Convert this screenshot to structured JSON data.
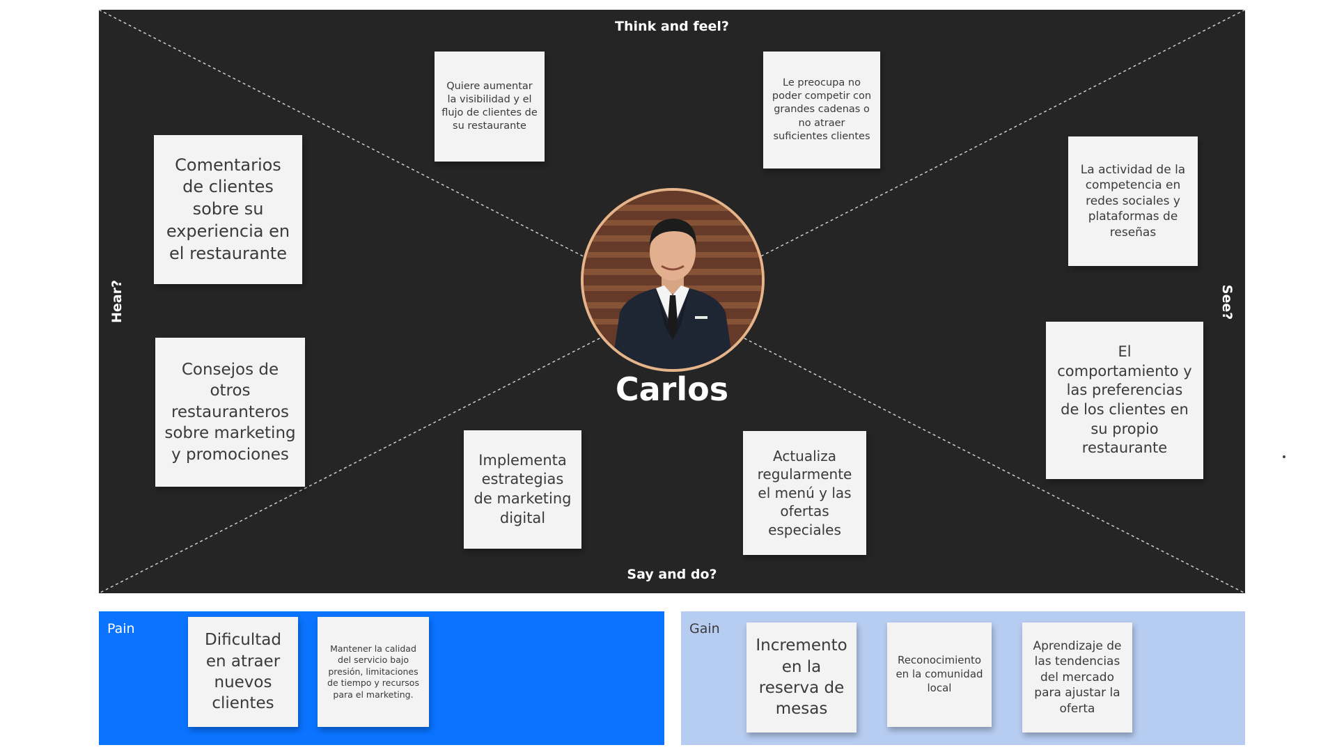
{
  "empathy_map": {
    "quadrants": {
      "top": "Think and feel?",
      "bottom": "Say and do?",
      "left": "Hear?",
      "right": "See?"
    },
    "persona": {
      "name": "Carlos",
      "photo": "portrait of a smiling man in a dark suit and tie"
    },
    "notes": {
      "think_1": "Quiere aumentar la visibilidad y el flujo de clientes de su restaurante",
      "think_2": "Le preocupa no poder competir con grandes cadenas o no atraer suficientes clientes",
      "hear_1": "Comentarios de clientes sobre su experiencia en el restaurante",
      "hear_2": "Consejos de otros restauranteros sobre marketing y promociones",
      "see_1": "La actividad de la competencia en redes sociales y plataformas de reseñas",
      "see_2": "El comportamiento y las preferencias de los clientes en su propio restaurante",
      "say_1": "Implementa estrategias de marketing digital",
      "say_2": "Actualiza regularmente el menú y las ofertas especiales"
    }
  },
  "pain": {
    "label": "Pain",
    "notes": [
      "Dificultad en atraer nuevos clientes",
      "Mantener la calidad del servicio bajo presión, limitaciones de tiempo y recursos para el marketing."
    ]
  },
  "gain": {
    "label": "Gain",
    "notes": [
      "Incremento en la reserva de mesas",
      "Reconocimiento en la comunidad local",
      "Aprendizaje de las tendencias del mercado para ajustar la oferta"
    ]
  },
  "colors": {
    "board": "#252525",
    "pain": "#0a73ff",
    "gain": "#b7ccf1",
    "sticky": "#f3f3f3",
    "avatar_ring": "#e6b48a"
  }
}
